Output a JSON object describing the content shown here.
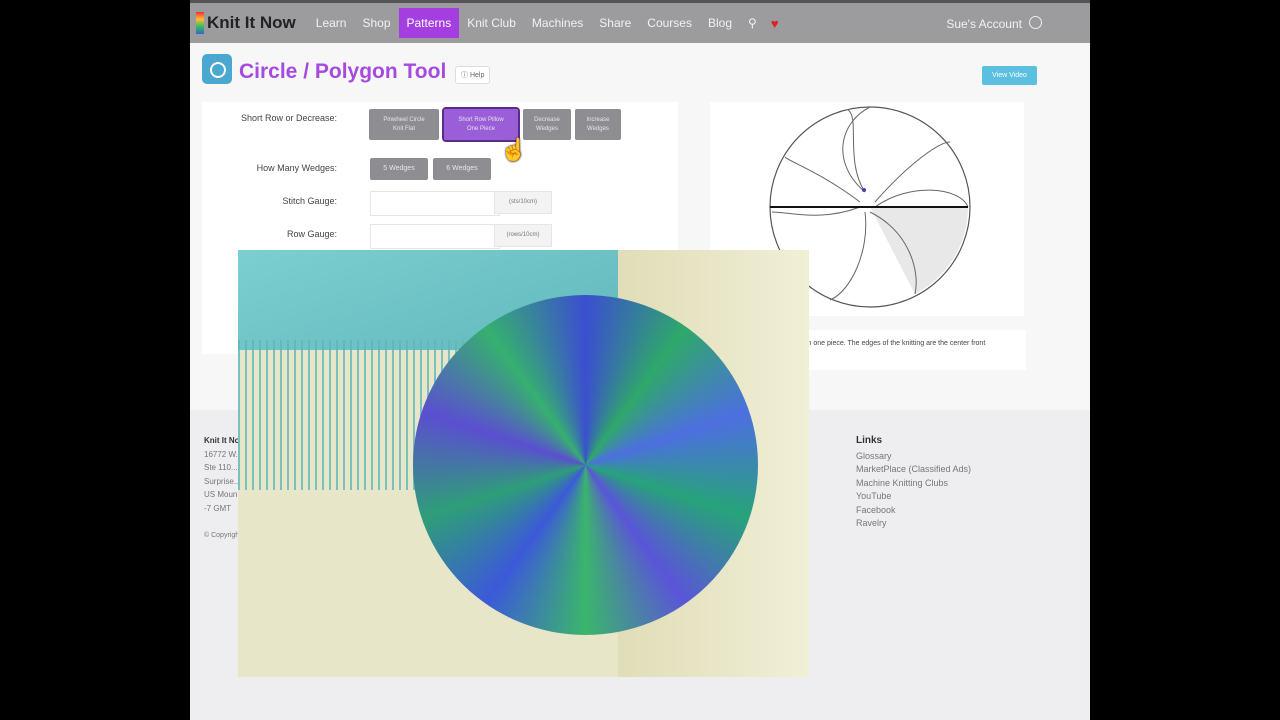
{
  "nav": {
    "logo": "Knit It Now",
    "items": [
      "Learn",
      "Shop",
      "Patterns",
      "Knit Club",
      "Machines",
      "Share",
      "Courses",
      "Blog"
    ],
    "active": "Patterns",
    "account": "Sue's Account"
  },
  "header": {
    "title": "Circle / Polygon Tool",
    "help": "Help",
    "video_button": "View Video"
  },
  "form": {
    "short_row_label": "Short Row or Decrease:",
    "short_row_options": [
      {
        "l1": "Pinwheel Circle",
        "l2": "Knit Flat"
      },
      {
        "l1": "Short Row Pillow",
        "l2": "One Piece"
      },
      {
        "l1": "Decrease",
        "l2": "Wedges"
      },
      {
        "l1": "Increase",
        "l2": "Wedges"
      }
    ],
    "wedges_label": "How Many Wedges:",
    "wedge_options": [
      "5 Wedges",
      "6 Wedges"
    ],
    "stitch_gauge_label": "Stitch Gauge:",
    "stitch_gauge_value": "",
    "stitch_gauge_unit": "(sts/10cm)",
    "row_gauge_label": "Row Gauge:",
    "row_gauge_value": "",
    "row_gauge_unit": "(rows/10cm)"
  },
  "description": "in one piece. The edges of the knitting are the center front",
  "footer": {
    "address": [
      "Knit It Now",
      "16772 W...",
      "Ste 110...",
      "Surprise...",
      "US Moun...",
      "-7 GMT"
    ],
    "copyright": "© Copyright",
    "links_title": "Links",
    "links": [
      "Glossary",
      "MarketPlace (Classified Ads)",
      "Machine Knitting Clubs",
      "YouTube",
      "Facebook",
      "Ravelry"
    ]
  }
}
